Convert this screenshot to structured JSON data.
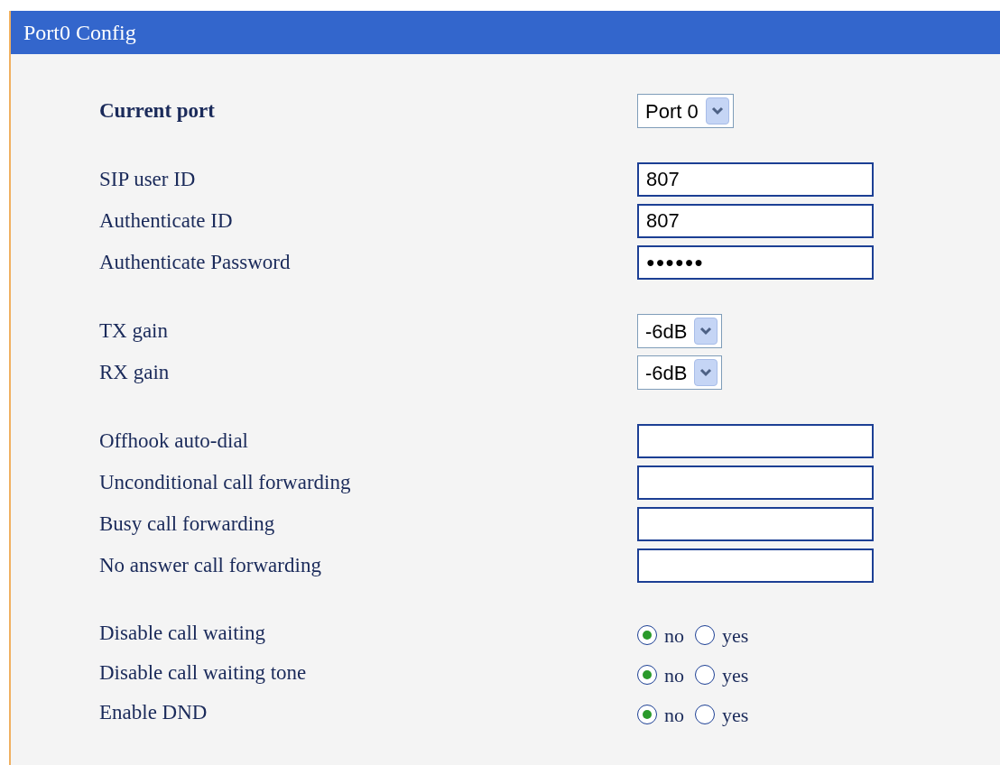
{
  "panel": {
    "title": "Port0 Config"
  },
  "groups": [
    {
      "rows": [
        {
          "kind": "select",
          "label": "Current port",
          "bold": true,
          "value": "Port 0"
        }
      ]
    },
    {
      "rows": [
        {
          "kind": "text",
          "label": "SIP user ID",
          "value": "807"
        },
        {
          "kind": "text",
          "label": "Authenticate ID",
          "value": "807"
        },
        {
          "kind": "password",
          "label": "Authenticate Password",
          "value": "●●●●●●"
        }
      ]
    },
    {
      "rows": [
        {
          "kind": "select",
          "label": "TX gain",
          "value": "-6dB"
        },
        {
          "kind": "select",
          "label": "RX gain",
          "value": "-6dB"
        }
      ]
    },
    {
      "rows": [
        {
          "kind": "text",
          "label": "Offhook auto-dial"
        },
        {
          "kind": "text",
          "label": "Unconditional call forwarding"
        },
        {
          "kind": "text",
          "label": "Busy call forwarding"
        },
        {
          "kind": "text",
          "label": "No answer call forwarding"
        }
      ]
    },
    {
      "rows": [
        {
          "kind": "radio",
          "label": "Disable call waiting",
          "options": [
            {
              "label": "no",
              "selected": true
            },
            {
              "label": "yes",
              "selected": false
            }
          ]
        },
        {
          "kind": "radio",
          "label": "Disable call waiting tone",
          "options": [
            {
              "label": "no",
              "selected": true
            },
            {
              "label": "yes",
              "selected": false
            }
          ]
        },
        {
          "kind": "radio",
          "label": "Enable DND",
          "options": [
            {
              "label": "no",
              "selected": true
            },
            {
              "label": "yes",
              "selected": false
            }
          ]
        }
      ]
    }
  ]
}
